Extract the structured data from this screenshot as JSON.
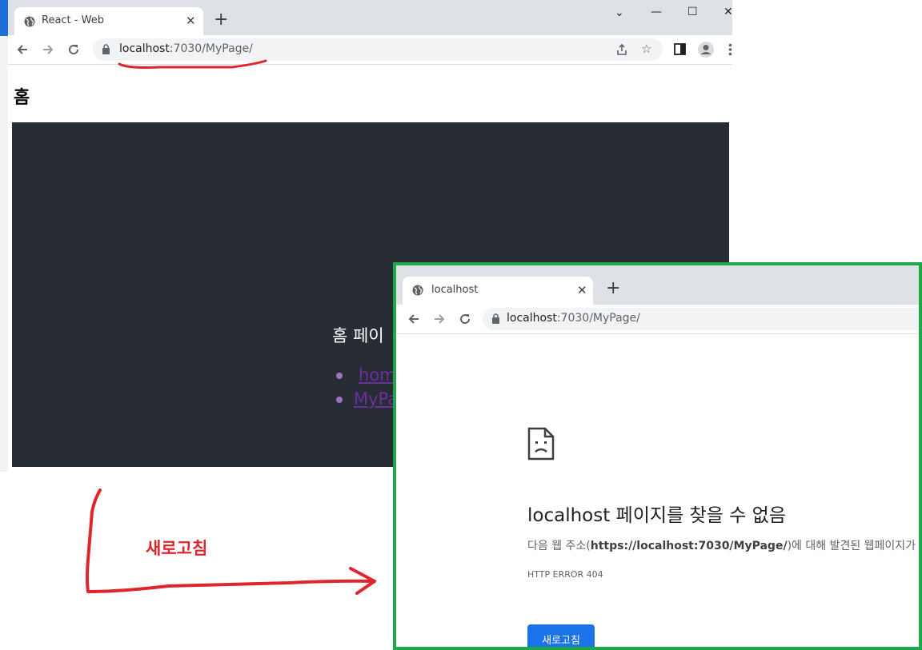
{
  "window1": {
    "tab_title": "React - Web",
    "tab_close": "✕",
    "new_tab": "+",
    "window_controls": {
      "collapse": "⌄",
      "minimize": "—",
      "maximize": "☐",
      "close": "✕"
    },
    "url_host": "localhost",
    "url_rest": ":7030/MyPage/",
    "page_heading": "홈",
    "app_text": "홈 페이",
    "nav_links": [
      "hom",
      "MyPa"
    ]
  },
  "window2": {
    "tab_title": "localhost",
    "tab_close": "✕",
    "new_tab": "+",
    "url_host": "localhost",
    "url_rest": ":7030/MyPage/",
    "error_title": "localhost 페이지를 찾을 수 없음",
    "error_desc_prefix": "다음 웹 주소(",
    "error_desc_url": "https://localhost:7030/MyPage/",
    "error_desc_suffix": ")에 대해 발견된 웹페이지가",
    "error_code": "HTTP ERROR 404",
    "reload_label": "새로고침"
  },
  "annotation": {
    "label": "새로고침",
    "color": "#e0262d",
    "frame_color": "#1fa84a"
  },
  "icons": {
    "favicon": "globe-icon",
    "back": "arrow-left-icon",
    "forward": "arrow-right-icon",
    "reload": "reload-icon",
    "lock": "lock-icon",
    "share": "share-icon",
    "bookmark": "star-icon",
    "sidepanel": "side-panel-icon",
    "profile": "profile-icon",
    "menu": "more-vertical-icon",
    "error_page": "sad-document-icon"
  },
  "colors": {
    "app_background": "#282c34",
    "link": "#6b2fa0",
    "button_blue": "#1a73e8"
  }
}
